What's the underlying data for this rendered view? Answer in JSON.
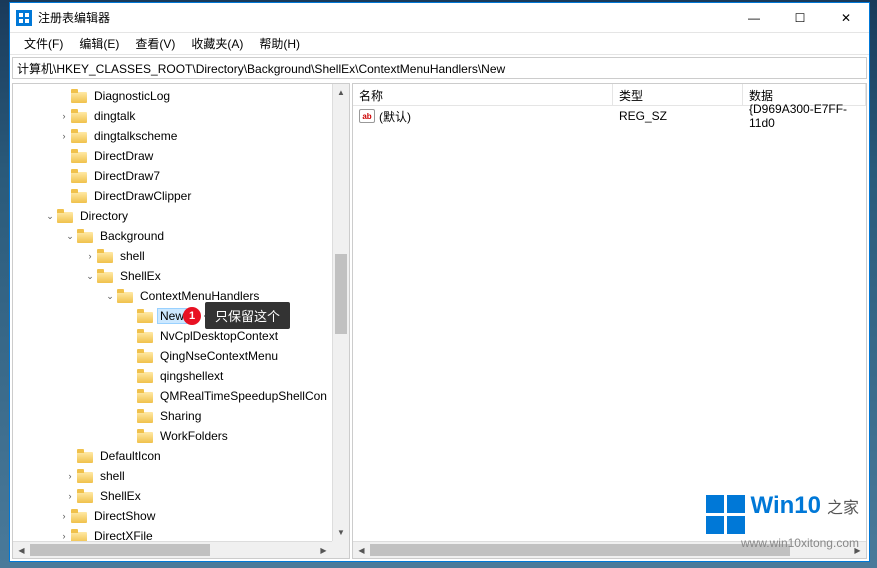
{
  "title": "注册表编辑器",
  "menu": {
    "file": "文件(F)",
    "edit": "编辑(E)",
    "view": "查看(V)",
    "fav": "收藏夹(A)",
    "help": "帮助(H)"
  },
  "address": "计算机\\HKEY_CLASSES_ROOT\\Directory\\Background\\ShellEx\\ContextMenuHandlers\\New",
  "tree": {
    "n0": "DiagnosticLog",
    "n1": "dingtalk",
    "n2": "dingtalkscheme",
    "n3": "DirectDraw",
    "n4": "DirectDraw7",
    "n5": "DirectDrawClipper",
    "n6": "Directory",
    "n7": "Background",
    "n8": "shell",
    "n9": "ShellEx",
    "n10": "ContextMenuHandlers",
    "n11": "New",
    "n12": "NvCplDesktopContext",
    "n13": "QingNseContextMenu",
    "n14": "qingshellext",
    "n15": "QMRealTimeSpeedupShellCon",
    "n16": "Sharing",
    "n17": "WorkFolders",
    "n18": "DefaultIcon",
    "n19": "shell",
    "n20": "ShellEx",
    "n21": "DirectShow",
    "n22": "DirectXFile"
  },
  "list": {
    "headers": {
      "name": "名称",
      "type": "类型",
      "data": "数据"
    },
    "row0": {
      "name": "(默认)",
      "type": "REG_SZ",
      "data": "{D969A300-E7FF-11d0"
    }
  },
  "annotation": {
    "num": "1",
    "text": "只保留这个"
  },
  "watermark": {
    "brand1": "Win10",
    "brand2": "之家",
    "url": "www.win10xitong.com"
  },
  "winbtns": {
    "min": "—",
    "max": "☐",
    "close": "✕"
  },
  "val_icon": "ab"
}
